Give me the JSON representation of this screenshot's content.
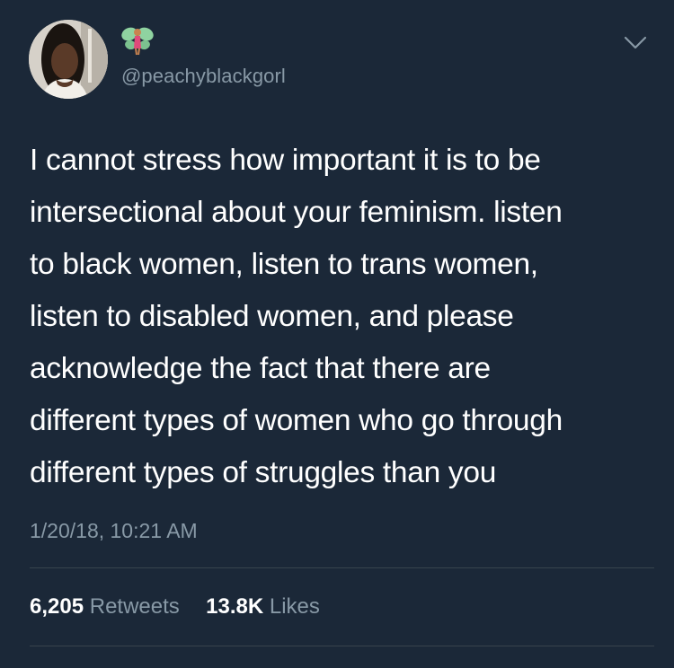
{
  "tweet": {
    "handle": "@peachyblackgorl",
    "name_icon": "fairy-emoji",
    "menu_icon": "chevron-down-icon",
    "text": "I cannot stress how important it is to be\nintersectional about your feminism. listen\nto black women, listen to trans women,\nlisten to disabled women, and please\nacknowledge the fact that there are\ndifferent types of women who go through\ndifferent types of struggles than you",
    "timestamp": "1/20/18, 10:21 AM",
    "retweets_count": "6,205",
    "retweets_label": "Retweets",
    "likes_count": "13.8K",
    "likes_label": "Likes"
  },
  "colors": {
    "background": "#1b2838",
    "text": "#ffffff",
    "secondary_text": "#8899a6",
    "divider": "#38444d"
  }
}
